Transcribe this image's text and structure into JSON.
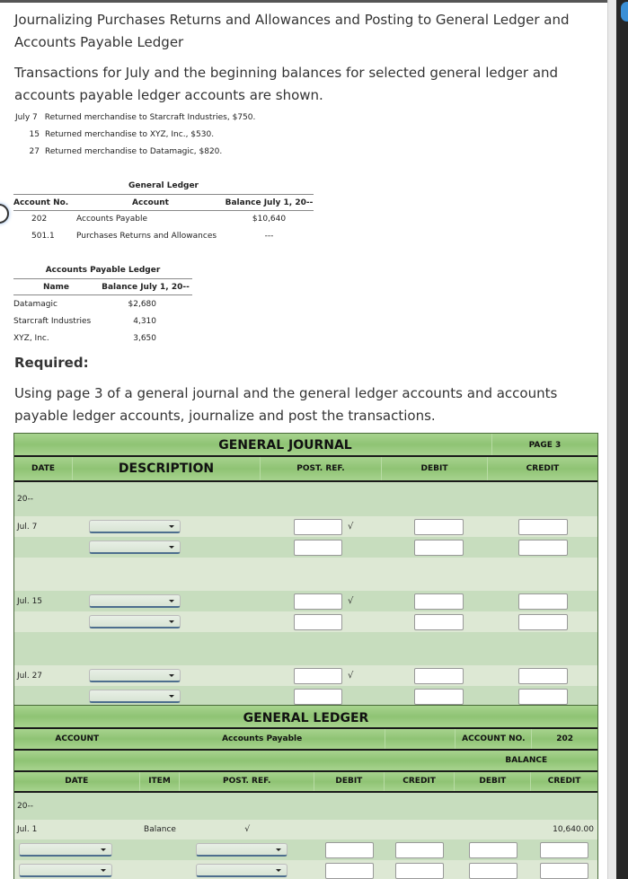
{
  "title": "Journalizing Purchases Returns and Allowances and Posting to General Ledger and Accounts Payable Ledger",
  "intro": "Transactions for July and the beginning balances for selected general ledger and accounts payable ledger accounts are shown.",
  "transactions": [
    {
      "date": "July 7",
      "text": "Returned merchandise to Starcraft Industries, $750."
    },
    {
      "date": "15",
      "text": "Returned merchandise to XYZ, Inc., $530."
    },
    {
      "date": "27",
      "text": "Returned merchandise to Datamagic, $820."
    }
  ],
  "general_ledger_ref": {
    "caption": "General Ledger",
    "headers": {
      "account_no": "Account No.",
      "account": "Account",
      "balance": "Balance July 1, 20--"
    },
    "rows": [
      {
        "account_no": "202",
        "account": "Accounts Payable",
        "balance": "$10,640"
      },
      {
        "account_no": "501.1",
        "account": "Purchases Returns and Allowances",
        "balance": "---"
      }
    ]
  },
  "ap_ledger_ref": {
    "caption": "Accounts Payable Ledger",
    "headers": {
      "name": "Name",
      "balance": "Balance July 1, 20--"
    },
    "rows": [
      {
        "name": "Datamagic",
        "balance": "$2,680"
      },
      {
        "name": "Starcraft Industries",
        "balance": "4,310"
      },
      {
        "name": "XYZ, Inc.",
        "balance": "3,650"
      }
    ]
  },
  "required_label": "Required:",
  "instructions": "Using page 3 of a general journal and the general ledger accounts and accounts payable ledger accounts, journalize and post the transactions.",
  "journal": {
    "title": "GENERAL JOURNAL",
    "page": "PAGE 3",
    "columns": {
      "date": "DATE",
      "description": "DESCRIPTION",
      "post_ref": "POST. REF.",
      "debit": "DEBIT",
      "credit": "CREDIT"
    },
    "year": "20--",
    "entries": [
      {
        "date": "Jul. 7",
        "check": "√"
      },
      {
        "date": "Jul. 15",
        "check": "√"
      },
      {
        "date": "Jul. 27",
        "check": "√"
      }
    ]
  },
  "ledger": {
    "title": "GENERAL LEDGER",
    "account_label": "ACCOUNT",
    "account_name": "Accounts Payable",
    "account_no_label": "ACCOUNT NO.",
    "account_no": "202",
    "balance_label": "BALANCE",
    "columns": {
      "date": "DATE",
      "item": "ITEM",
      "post_ref": "POST. REF.",
      "debit": "DEBIT",
      "credit": "CREDIT",
      "bal_debit": "DEBIT",
      "bal_credit": "CREDIT"
    },
    "year": "20--",
    "opening": {
      "date": "Jul. 1",
      "item": "Balance",
      "post_ref": "√",
      "bal_credit": "10,640.00"
    }
  }
}
